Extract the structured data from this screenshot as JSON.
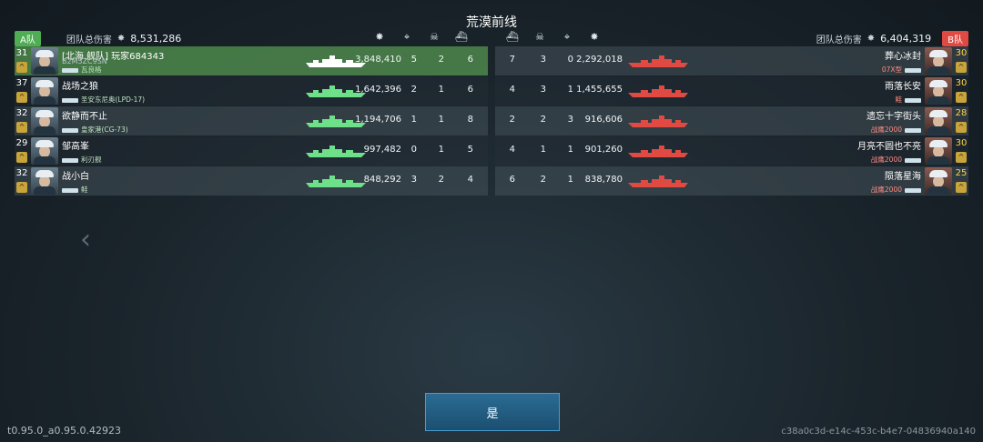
{
  "title": "荒漠前线",
  "team_a": {
    "tag": "A队",
    "damage_label": "团队总伤害",
    "damage_total": "8,531,286",
    "players": [
      {
        "level": "31",
        "name": "[北海.舰队] 玩家684343",
        "sub": "B2M5ZC9SN",
        "ship": "瓦良格",
        "damage": "3,848,410",
        "kills": "5",
        "assists": "2",
        "hits": "6",
        "self": true
      },
      {
        "level": "37",
        "name": "战场之狼",
        "sub": "",
        "ship": "圣安东尼奥(LPD-17)",
        "damage": "1,642,396",
        "kills": "2",
        "assists": "1",
        "hits": "6",
        "self": false
      },
      {
        "level": "32",
        "name": "欲静而不止",
        "sub": "",
        "ship": "皇家港(CG-73)",
        "damage": "1,194,706",
        "kills": "1",
        "assists": "1",
        "hits": "8",
        "self": false
      },
      {
        "level": "29",
        "name": "邹高峯",
        "sub": "",
        "ship": "利刃舰",
        "damage": "997,482",
        "kills": "0",
        "assists": "1",
        "hits": "5",
        "self": false
      },
      {
        "level": "32",
        "name": "战小白",
        "sub": "",
        "ship": "鲑",
        "damage": "848,292",
        "kills": "3",
        "assists": "2",
        "hits": "4",
        "self": false
      }
    ]
  },
  "team_b": {
    "tag": "B队",
    "damage_label": "团队总伤害",
    "damage_total": "6,404,319",
    "players": [
      {
        "level": "30",
        "name": "葬心冰封",
        "ship": "07X型",
        "hits": "7",
        "assists": "3",
        "kills": "0",
        "damage": "2,292,018"
      },
      {
        "level": "30",
        "name": "雨落长安",
        "ship": "鲑",
        "hits": "4",
        "assists": "3",
        "kills": "1",
        "damage": "1,455,655"
      },
      {
        "level": "28",
        "name": "遗忘十字街头",
        "ship": "战鹰2000",
        "hits": "2",
        "assists": "2",
        "kills": "3",
        "damage": "916,606"
      },
      {
        "level": "30",
        "name": "月亮不圆也不亮",
        "ship": "战鹰2000",
        "hits": "4",
        "assists": "1",
        "kills": "1",
        "damage": "901,260"
      },
      {
        "level": "25",
        "name": "陨落星海",
        "ship": "战鹰2000",
        "hits": "6",
        "assists": "2",
        "kills": "1",
        "damage": "838,780"
      }
    ]
  },
  "column_icons_a": [
    "damage-icon",
    "crosshair-icon",
    "skull-icon",
    "ship-icon"
  ],
  "column_icons_b": [
    "ship-icon",
    "skull-icon",
    "crosshair-icon",
    "damage-icon"
  ],
  "confirm_label": "是",
  "version": "t0.95.0_a0.95.0.42923",
  "session_id": "c38a0c3d-e14c-453c-b4e7-04836940a140",
  "colors": {
    "team_a": "#4fae53",
    "team_b": "#e14a43",
    "self_row": "#549650",
    "button": "#2b6b93"
  }
}
